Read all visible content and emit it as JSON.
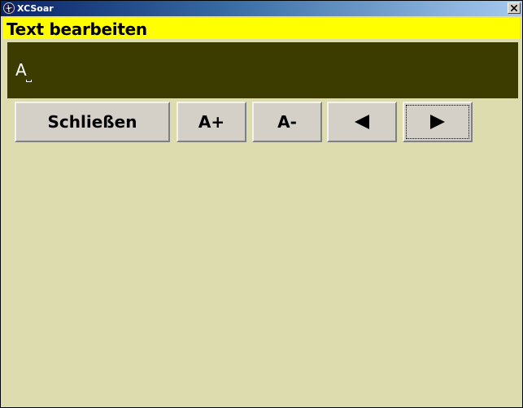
{
  "window": {
    "title": "XCSoar"
  },
  "dialog": {
    "caption": "Text bearbeiten",
    "caption_color": "#ffff00",
    "background_color": "#dcdcaf"
  },
  "text_field": {
    "value": "A",
    "background_color": "#3c3c00"
  },
  "buttons": {
    "close_label": "Schließen",
    "increase_label": "A+",
    "decrease_label": "A-",
    "left_icon": "left-arrow-icon",
    "right_icon": "right-arrow-icon"
  }
}
